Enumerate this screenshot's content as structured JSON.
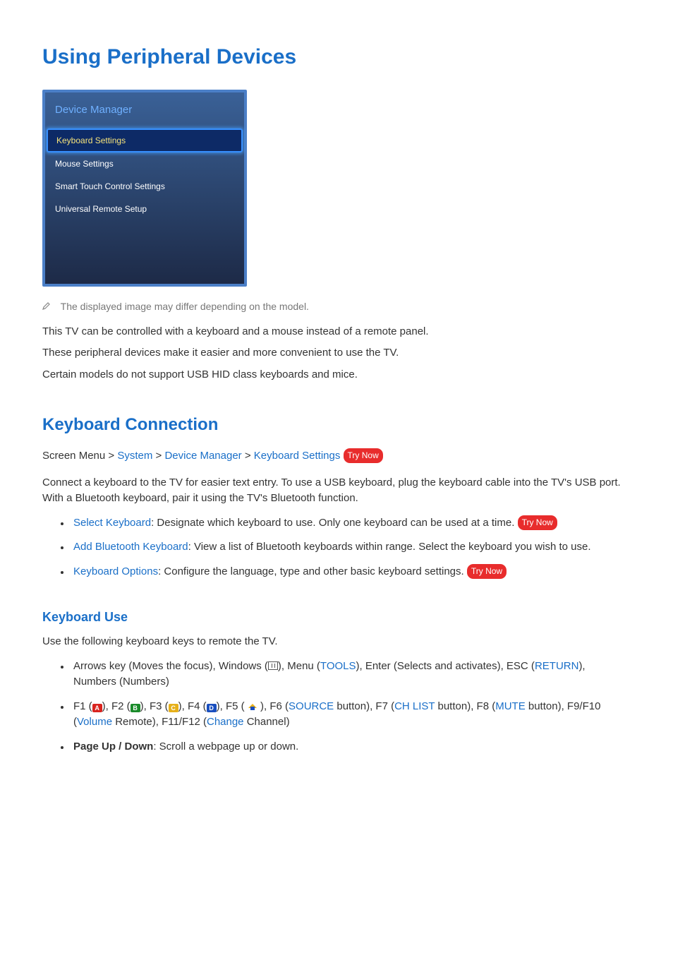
{
  "title": "Using Peripheral Devices",
  "menu": {
    "title": "Device Manager",
    "items": [
      {
        "label": "Keyboard Settings",
        "selected": true
      },
      {
        "label": "Mouse Settings",
        "selected": false
      },
      {
        "label": "Smart Touch Control Settings",
        "selected": false
      },
      {
        "label": "Universal Remote Setup",
        "selected": false
      }
    ]
  },
  "note": "The displayed image may differ depending on the model.",
  "para1": "This TV can be controlled with a keyboard and a mouse instead of a remote panel.",
  "para2": "These peripheral devices make it easier and more convenient to use the TV.",
  "para3": "Certain models do not support USB HID class keyboards and mice.",
  "section1": {
    "title": "Keyboard Connection",
    "nav_prefix": "Screen Menu",
    "nav_parts": [
      "System",
      "Device Manager",
      "Keyboard Settings"
    ],
    "try_now": "Try Now",
    "desc": "Connect a keyboard to the TV for easier text entry. To use a USB keyboard, plug the keyboard cable into the TV's USB port. With a Bluetooth keyboard, pair it using the TV's Bluetooth function.",
    "items": [
      {
        "name": "Select Keyboard",
        "text": ": Designate which keyboard to use. Only one keyboard can be used at a time. ",
        "try_now": "Try Now"
      },
      {
        "name": "Add Bluetooth Keyboard",
        "text": ": View a list of Bluetooth keyboards within range. Select the keyboard you wish to use."
      },
      {
        "name": "Keyboard Options",
        "text": ": Configure the language, type and other basic keyboard settings. ",
        "try_now": "Try Now"
      }
    ]
  },
  "section2": {
    "title": "Keyboard Use",
    "desc": "Use the following keyboard keys to remote the TV.",
    "li1": {
      "a": "Arrows key (Moves the focus), Windows (",
      "b": "), Menu (",
      "tools": "TOOLS",
      "c": "), Enter (Selects and activates), ESC (",
      "return": "RETURN",
      "d": "), Numbers (Numbers)"
    },
    "li2": {
      "f1": "F1 (",
      "keyA": "A",
      "f2": "), F2 (",
      "keyB": "B",
      "f3": "), F3 (",
      "keyC": "C",
      "f4": "), F4 (",
      "keyD": "D",
      "f5": "), F5 ( ",
      "f6": " ), F6 (",
      "source": "SOURCE",
      "f6b": " button), F7 (",
      "chlist": "CH LIST",
      "f7b": " button), F8 (",
      "mute": "MUTE",
      "f8b": " button), F9/F10 (",
      "volume": "Volume",
      "f9b": " Remote), F11/F12 (",
      "change": "Change",
      "f12b": " Channel)"
    },
    "li3": {
      "label": "Page Up / Down",
      "text": ": Scroll a webpage up or down."
    }
  }
}
